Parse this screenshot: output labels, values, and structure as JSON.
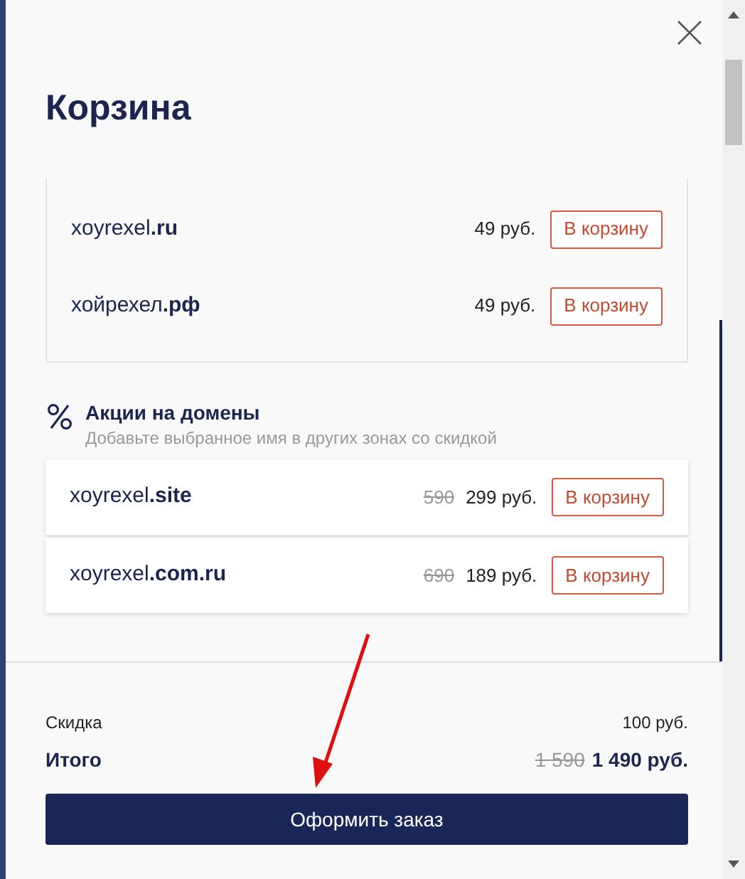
{
  "title": "Корзина",
  "domains": [
    {
      "name": "xoyrexel",
      "zone": ".ru",
      "price": "49 руб.",
      "button": "В корзину"
    },
    {
      "name": "хойрехел",
      "zone": ".рф",
      "price": "49 руб.",
      "button": "В корзину"
    }
  ],
  "promo": {
    "title": "Акции на домены",
    "subtitle": "Добавьте выбранное имя в других зонах со скидкой",
    "items": [
      {
        "name": "xoyrexel",
        "zone": ".site",
        "old_price": "590",
        "price": "299 руб.",
        "button": "В корзину"
      },
      {
        "name": "xoyrexel",
        "zone": ".com.ru",
        "old_price": "690",
        "price": "189 руб.",
        "button": "В корзину"
      }
    ]
  },
  "summary": {
    "discount_label": "Скидка",
    "discount": "100 руб.",
    "total_label": "Итого",
    "old_total": "1 590",
    "total": "1 490 руб."
  },
  "checkout": "Оформить заказ"
}
